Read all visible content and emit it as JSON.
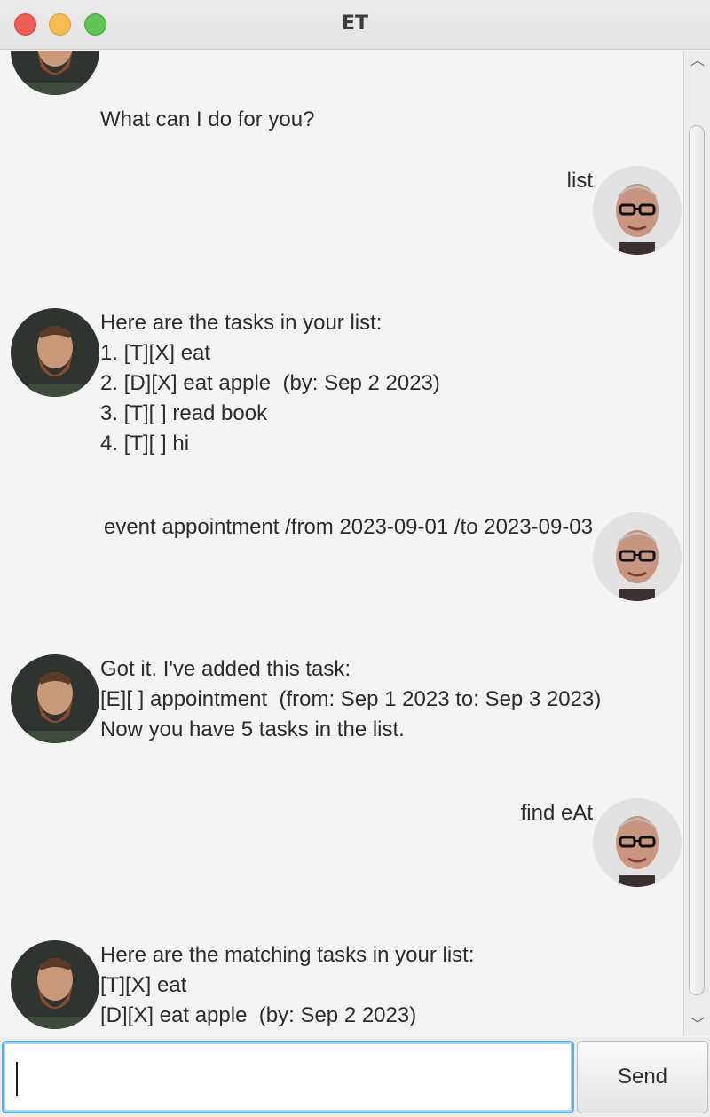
{
  "window": {
    "title": "ET"
  },
  "messages": [
    {
      "sender": "bot",
      "avatar_icon": "bearded-man-avatar-icon",
      "text": "What can I do for you?"
    },
    {
      "sender": "user",
      "avatar_icon": "glasses-man-avatar-icon",
      "text": "list"
    },
    {
      "sender": "bot",
      "avatar_icon": "bearded-man-avatar-icon",
      "text": "Here are the tasks in your list:\n1. [T][X] eat\n2. [D][X] eat apple  (by: Sep 2 2023)\n3. [T][ ] read book\n4. [T][ ] hi"
    },
    {
      "sender": "user",
      "avatar_icon": "glasses-man-avatar-icon",
      "text": "event appointment /from 2023-09-01 /to 2023-09-03"
    },
    {
      "sender": "bot",
      "avatar_icon": "bearded-man-avatar-icon",
      "text": "Got it. I've added this task:\n[E][ ] appointment  (from: Sep 1 2023 to: Sep 3 2023)\nNow you have 5 tasks in the list."
    },
    {
      "sender": "user",
      "avatar_icon": "glasses-man-avatar-icon",
      "text": "find eAt"
    },
    {
      "sender": "bot",
      "avatar_icon": "bearded-man-avatar-icon",
      "text": "Here are the matching tasks in your list:\n[T][X] eat\n[D][X] eat apple  (by: Sep 2 2023)"
    }
  ],
  "input": {
    "value": "",
    "placeholder": ""
  },
  "send_button": {
    "label": "Send"
  },
  "colors": {
    "focus_ring": "#5aaee8",
    "background": "#f4f4f4"
  }
}
